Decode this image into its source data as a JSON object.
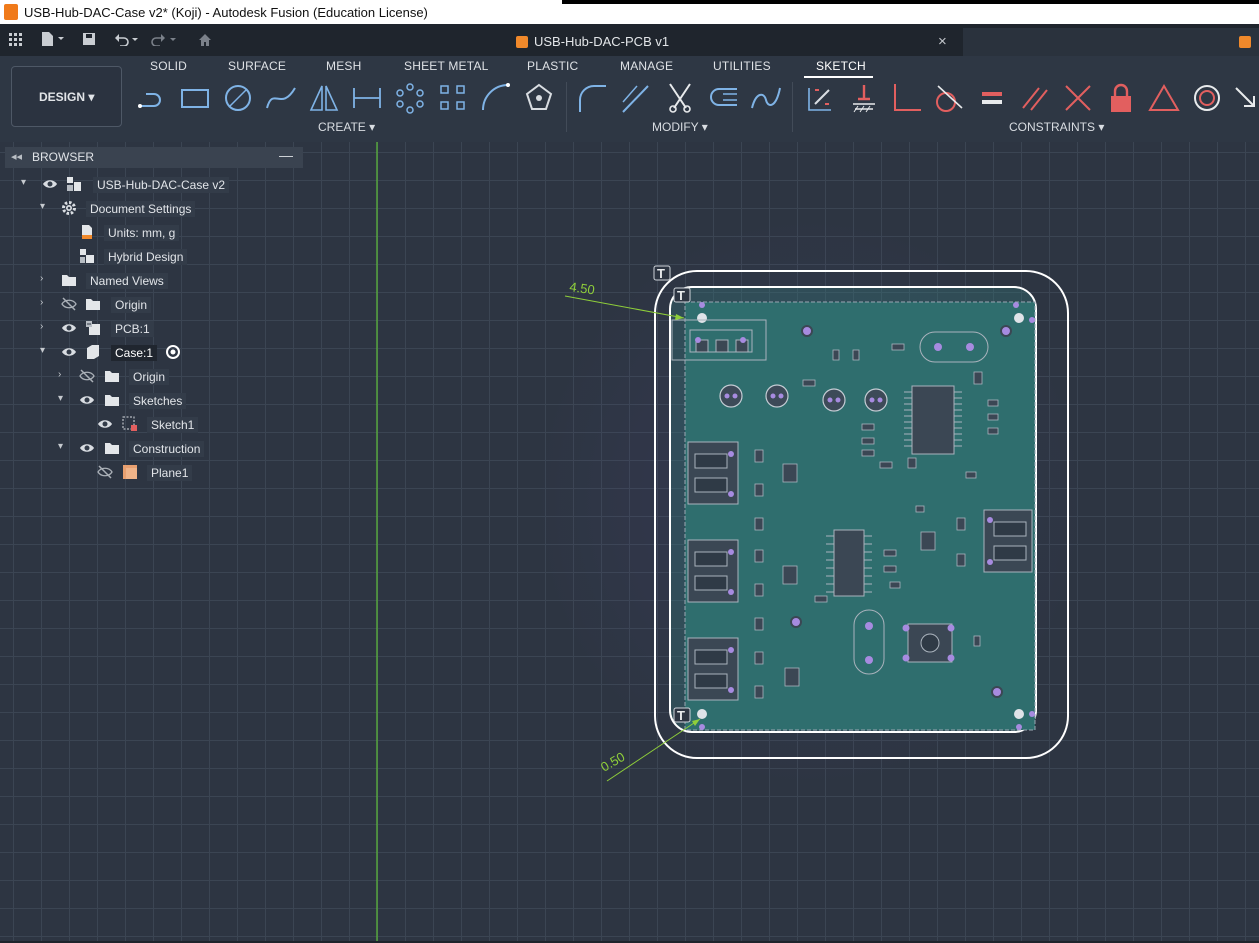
{
  "window": {
    "title": "USB-Hub-DAC-Case v2* (Koji) - Autodesk Fusion (Education License)"
  },
  "document_tab": {
    "label": "USB-Hub-DAC-PCB v1",
    "close": "×"
  },
  "ribbon": {
    "workspace": "DESIGN ▾",
    "tabs": [
      "SOLID",
      "SURFACE",
      "MESH",
      "SHEET METAL",
      "PLASTIC",
      "MANAGE",
      "UTILITIES",
      "SKETCH"
    ],
    "active_tab": "SKETCH",
    "groups": {
      "create": "CREATE ▾",
      "modify": "MODIFY ▾",
      "constraints": "CONSTRAINTS ▾"
    }
  },
  "browser": {
    "title": "BROWSER",
    "nodes": [
      {
        "label": "USB-Hub-DAC-Case v2",
        "icon": "component-icon",
        "visible": true
      },
      {
        "label": "Document Settings",
        "icon": "gear-icon"
      },
      {
        "label": "Units: mm, g",
        "icon": "document-icon"
      },
      {
        "label": "Hybrid Design",
        "icon": "hybrid-icon"
      },
      {
        "label": "Named Views",
        "icon": "folder-icon"
      },
      {
        "label": "Origin",
        "icon": "folder-icon",
        "visible": false
      },
      {
        "label": "PCB:1",
        "icon": "linked-component-icon",
        "visible": true
      },
      {
        "label": "Case:1",
        "icon": "component-icon",
        "visible": true,
        "active": true
      },
      {
        "label": "Origin",
        "icon": "folder-icon",
        "visible": false
      },
      {
        "label": "Sketches",
        "icon": "folder-icon",
        "visible": true
      },
      {
        "label": "Sketch1",
        "icon": "sketch-icon",
        "visible": true
      },
      {
        "label": "Construction",
        "icon": "folder-icon",
        "visible": true
      },
      {
        "label": "Plane1",
        "icon": "plane-icon",
        "visible": false
      }
    ]
  },
  "canvas": {
    "dimensions": [
      "4.50",
      "0.50"
    ],
    "colors": {
      "dimension": "#8fcf3a",
      "profile": "#ffffff",
      "pcb_fill": "#2f6e6e",
      "pad": "#a78be0"
    }
  }
}
